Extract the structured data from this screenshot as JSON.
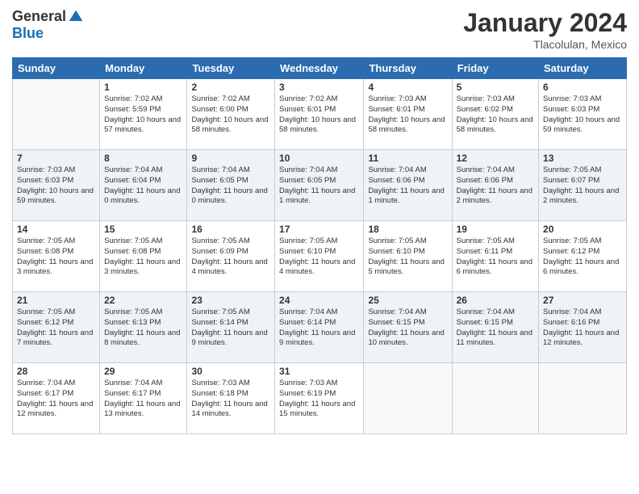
{
  "header": {
    "logo_general": "General",
    "logo_blue": "Blue",
    "month_year": "January 2024",
    "location": "Tlacolulan, Mexico"
  },
  "days_of_week": [
    "Sunday",
    "Monday",
    "Tuesday",
    "Wednesday",
    "Thursday",
    "Friday",
    "Saturday"
  ],
  "weeks": [
    [
      {
        "day": "",
        "sunrise": "",
        "sunset": "",
        "daylight": ""
      },
      {
        "day": "1",
        "sunrise": "Sunrise: 7:02 AM",
        "sunset": "Sunset: 5:59 PM",
        "daylight": "Daylight: 10 hours and 57 minutes."
      },
      {
        "day": "2",
        "sunrise": "Sunrise: 7:02 AM",
        "sunset": "Sunset: 6:00 PM",
        "daylight": "Daylight: 10 hours and 58 minutes."
      },
      {
        "day": "3",
        "sunrise": "Sunrise: 7:02 AM",
        "sunset": "Sunset: 6:01 PM",
        "daylight": "Daylight: 10 hours and 58 minutes."
      },
      {
        "day": "4",
        "sunrise": "Sunrise: 7:03 AM",
        "sunset": "Sunset: 6:01 PM",
        "daylight": "Daylight: 10 hours and 58 minutes."
      },
      {
        "day": "5",
        "sunrise": "Sunrise: 7:03 AM",
        "sunset": "Sunset: 6:02 PM",
        "daylight": "Daylight: 10 hours and 58 minutes."
      },
      {
        "day": "6",
        "sunrise": "Sunrise: 7:03 AM",
        "sunset": "Sunset: 6:03 PM",
        "daylight": "Daylight: 10 hours and 59 minutes."
      }
    ],
    [
      {
        "day": "7",
        "sunrise": "Sunrise: 7:03 AM",
        "sunset": "Sunset: 6:03 PM",
        "daylight": "Daylight: 10 hours and 59 minutes."
      },
      {
        "day": "8",
        "sunrise": "Sunrise: 7:04 AM",
        "sunset": "Sunset: 6:04 PM",
        "daylight": "Daylight: 11 hours and 0 minutes."
      },
      {
        "day": "9",
        "sunrise": "Sunrise: 7:04 AM",
        "sunset": "Sunset: 6:05 PM",
        "daylight": "Daylight: 11 hours and 0 minutes."
      },
      {
        "day": "10",
        "sunrise": "Sunrise: 7:04 AM",
        "sunset": "Sunset: 6:05 PM",
        "daylight": "Daylight: 11 hours and 1 minute."
      },
      {
        "day": "11",
        "sunrise": "Sunrise: 7:04 AM",
        "sunset": "Sunset: 6:06 PM",
        "daylight": "Daylight: 11 hours and 1 minute."
      },
      {
        "day": "12",
        "sunrise": "Sunrise: 7:04 AM",
        "sunset": "Sunset: 6:06 PM",
        "daylight": "Daylight: 11 hours and 2 minutes."
      },
      {
        "day": "13",
        "sunrise": "Sunrise: 7:05 AM",
        "sunset": "Sunset: 6:07 PM",
        "daylight": "Daylight: 11 hours and 2 minutes."
      }
    ],
    [
      {
        "day": "14",
        "sunrise": "Sunrise: 7:05 AM",
        "sunset": "Sunset: 6:08 PM",
        "daylight": "Daylight: 11 hours and 3 minutes."
      },
      {
        "day": "15",
        "sunrise": "Sunrise: 7:05 AM",
        "sunset": "Sunset: 6:08 PM",
        "daylight": "Daylight: 11 hours and 3 minutes."
      },
      {
        "day": "16",
        "sunrise": "Sunrise: 7:05 AM",
        "sunset": "Sunset: 6:09 PM",
        "daylight": "Daylight: 11 hours and 4 minutes."
      },
      {
        "day": "17",
        "sunrise": "Sunrise: 7:05 AM",
        "sunset": "Sunset: 6:10 PM",
        "daylight": "Daylight: 11 hours and 4 minutes."
      },
      {
        "day": "18",
        "sunrise": "Sunrise: 7:05 AM",
        "sunset": "Sunset: 6:10 PM",
        "daylight": "Daylight: 11 hours and 5 minutes."
      },
      {
        "day": "19",
        "sunrise": "Sunrise: 7:05 AM",
        "sunset": "Sunset: 6:11 PM",
        "daylight": "Daylight: 11 hours and 6 minutes."
      },
      {
        "day": "20",
        "sunrise": "Sunrise: 7:05 AM",
        "sunset": "Sunset: 6:12 PM",
        "daylight": "Daylight: 11 hours and 6 minutes."
      }
    ],
    [
      {
        "day": "21",
        "sunrise": "Sunrise: 7:05 AM",
        "sunset": "Sunset: 6:12 PM",
        "daylight": "Daylight: 11 hours and 7 minutes."
      },
      {
        "day": "22",
        "sunrise": "Sunrise: 7:05 AM",
        "sunset": "Sunset: 6:13 PM",
        "daylight": "Daylight: 11 hours and 8 minutes."
      },
      {
        "day": "23",
        "sunrise": "Sunrise: 7:05 AM",
        "sunset": "Sunset: 6:14 PM",
        "daylight": "Daylight: 11 hours and 9 minutes."
      },
      {
        "day": "24",
        "sunrise": "Sunrise: 7:04 AM",
        "sunset": "Sunset: 6:14 PM",
        "daylight": "Daylight: 11 hours and 9 minutes."
      },
      {
        "day": "25",
        "sunrise": "Sunrise: 7:04 AM",
        "sunset": "Sunset: 6:15 PM",
        "daylight": "Daylight: 11 hours and 10 minutes."
      },
      {
        "day": "26",
        "sunrise": "Sunrise: 7:04 AM",
        "sunset": "Sunset: 6:15 PM",
        "daylight": "Daylight: 11 hours and 11 minutes."
      },
      {
        "day": "27",
        "sunrise": "Sunrise: 7:04 AM",
        "sunset": "Sunset: 6:16 PM",
        "daylight": "Daylight: 11 hours and 12 minutes."
      }
    ],
    [
      {
        "day": "28",
        "sunrise": "Sunrise: 7:04 AM",
        "sunset": "Sunset: 6:17 PM",
        "daylight": "Daylight: 11 hours and 12 minutes."
      },
      {
        "day": "29",
        "sunrise": "Sunrise: 7:04 AM",
        "sunset": "Sunset: 6:17 PM",
        "daylight": "Daylight: 11 hours and 13 minutes."
      },
      {
        "day": "30",
        "sunrise": "Sunrise: 7:03 AM",
        "sunset": "Sunset: 6:18 PM",
        "daylight": "Daylight: 11 hours and 14 minutes."
      },
      {
        "day": "31",
        "sunrise": "Sunrise: 7:03 AM",
        "sunset": "Sunset: 6:19 PM",
        "daylight": "Daylight: 11 hours and 15 minutes."
      },
      {
        "day": "",
        "sunrise": "",
        "sunset": "",
        "daylight": ""
      },
      {
        "day": "",
        "sunrise": "",
        "sunset": "",
        "daylight": ""
      },
      {
        "day": "",
        "sunrise": "",
        "sunset": "",
        "daylight": ""
      }
    ]
  ]
}
